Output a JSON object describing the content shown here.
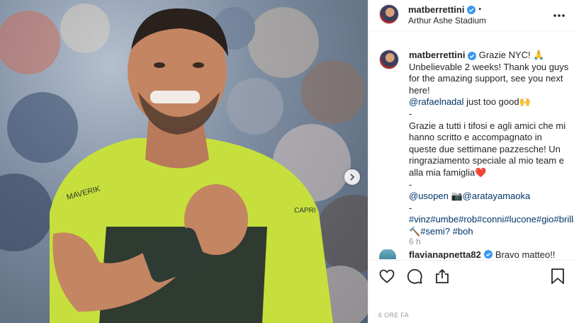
{
  "post": {
    "username": "matberrettini",
    "dot": "•",
    "location": "Arthur Ashe Stadium"
  },
  "caption": {
    "username": "matberrettini",
    "line1": " Grazie NYC! 🙏",
    "line2": "Unbelievable 2 weeks! Thank you guys for the amazing support, see you next here!",
    "mention1": "@rafaelnadal",
    "line3": " just too good🙌",
    "dash1": "-",
    "line4": "Grazie a tutti i tifosi e agli amici che mi hanno scritto e accompagnato in queste due settimane pazzesche! Un ringraziamento speciale al mio team e alla mia famiglia❤️",
    "dash2": "-",
    "mention2": "@usopen",
    "camera": " 📷",
    "mention3": "@aratayamaoka",
    "dash3": "-",
    "hashtags": "#vinz#umbe#rob#conni#lucone#gio#brilla#sempre",
    "hammer": "🔨",
    "hashtags2": "#semi? #boh",
    "time": "6 h"
  },
  "comment": {
    "username": "flavianapnetta82",
    "text": " Bravo matteo!!"
  },
  "footer": {
    "date": "6 ORE FA"
  },
  "icons": {
    "verified": "verified-badge-icon",
    "more": "more-options-icon",
    "next": "chevron-right-icon",
    "like": "heart-icon",
    "comment": "comment-icon",
    "share": "share-icon",
    "save": "bookmark-icon"
  },
  "colors": {
    "verified": "#3897f0",
    "mention": "#003569",
    "text": "#262626",
    "muted": "#999999",
    "jersey": "#c6df3c"
  }
}
